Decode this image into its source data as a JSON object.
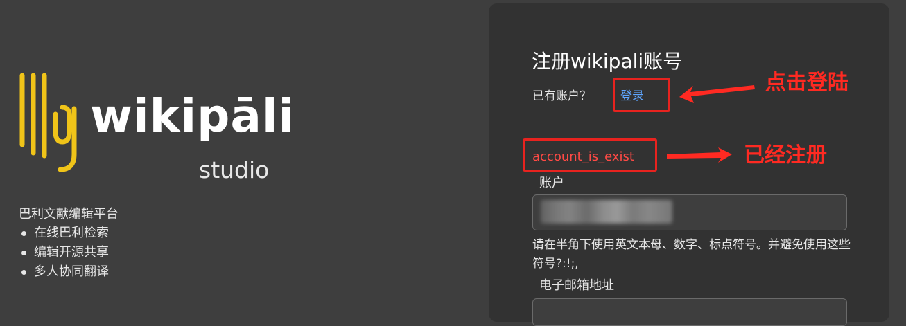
{
  "brand": {
    "name": "wikipāli",
    "subtitle": "studio",
    "logo_color": "#f0c419"
  },
  "intro": {
    "title": "巴利文献编辑平台",
    "features": [
      "在线巴利检索",
      "编辑开源共享",
      "多人协同翻译"
    ]
  },
  "form": {
    "title": "注册wikipali账号",
    "have_account": "已有账户？",
    "login_link": "登录",
    "error": "account_is_exist",
    "account_label": "账户",
    "account_value": "",
    "account_help": "请在半角下使用英文本母、数字、标点符号。并避免使用这些符号?:!;,",
    "email_label": "电子邮箱地址",
    "email_value": ""
  },
  "annotations": {
    "login_note": "点击登陆",
    "registered_note": "已经注册",
    "color": "#ff2a22"
  },
  "colors": {
    "background": "#3e3e3e",
    "panel": "#323232",
    "link": "#5fa6ff",
    "error": "#ff4a45"
  }
}
